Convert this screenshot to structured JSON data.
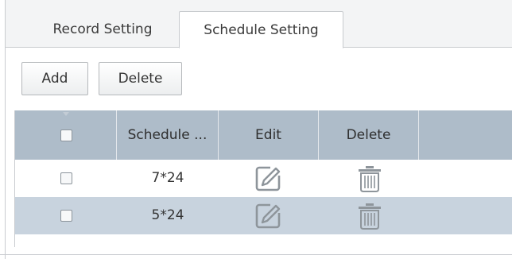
{
  "tabs": [
    {
      "label": "Record Setting",
      "active": false
    },
    {
      "label": "Schedule Setting",
      "active": true
    }
  ],
  "toolbar": {
    "add_label": "Add",
    "delete_label": "Delete"
  },
  "table": {
    "columns": [
      "",
      "Schedule ...",
      "Edit",
      "Delete",
      ""
    ],
    "rows": [
      {
        "checked": false,
        "schedule": "7*24",
        "edit_icon": "edit-icon",
        "delete_icon": "trash-icon"
      },
      {
        "checked": false,
        "schedule": "5*24",
        "edit_icon": "edit-icon",
        "delete_icon": "trash-icon"
      }
    ]
  },
  "colors": {
    "header_bg": "#aebcc9",
    "alt_row_bg": "#c8d3de",
    "tab_bar_bg": "#f3f4f5",
    "icon_gray": "#8e959b"
  }
}
